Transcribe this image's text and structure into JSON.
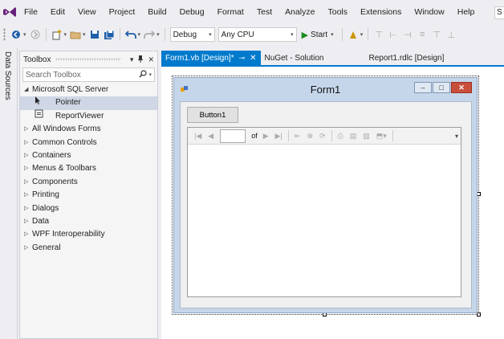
{
  "menu": {
    "items": [
      "File",
      "Edit",
      "View",
      "Project",
      "Build",
      "Debug",
      "Format",
      "Test",
      "Analyze",
      "Tools",
      "Extensions",
      "Window",
      "Help"
    ],
    "search_stub": "S"
  },
  "toolbar": {
    "config": "Debug",
    "platform": "Any CPU",
    "start_label": "Start"
  },
  "side_tab": {
    "label": "Data Sources"
  },
  "toolbox": {
    "title": "Toolbox",
    "search_placeholder": "Search Toolbox",
    "groups": [
      {
        "label": "Microsoft SQL Server",
        "expanded": true
      },
      {
        "label": "All Windows Forms"
      },
      {
        "label": "Common Controls"
      },
      {
        "label": "Containers"
      },
      {
        "label": "Menus & Toolbars"
      },
      {
        "label": "Components"
      },
      {
        "label": "Printing"
      },
      {
        "label": "Dialogs"
      },
      {
        "label": "Data"
      },
      {
        "label": "WPF Interoperability"
      },
      {
        "label": "General"
      }
    ],
    "sql_items": [
      {
        "label": "Pointer",
        "selected": true
      },
      {
        "label": "ReportViewer"
      }
    ]
  },
  "tabs": [
    {
      "label": "Form1.vb [Design]*",
      "active": true
    },
    {
      "label": "NuGet - Solution"
    },
    {
      "label": "Report1.rdlc [Design]"
    }
  ],
  "form": {
    "title": "Form1",
    "button_label": "Button1",
    "report_toolbar": {
      "of_label": "of"
    }
  },
  "colors": {
    "accent": "#007acc",
    "selection": "#cfd6e5",
    "close": "#c94f3b"
  }
}
